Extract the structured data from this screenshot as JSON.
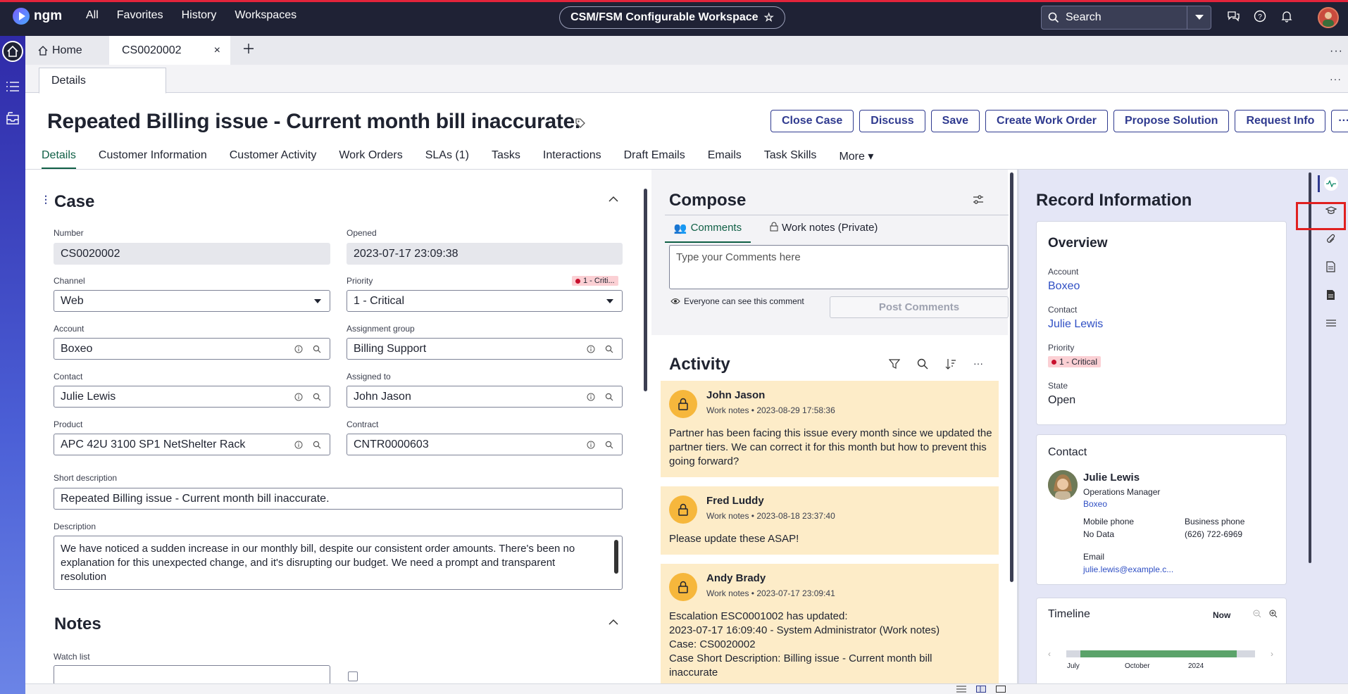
{
  "topbar": {
    "brand": "ngm",
    "nav": [
      "All",
      "Favorites",
      "History",
      "Workspaces"
    ],
    "workspace": "CSM/FSM Configurable Workspace",
    "search_placeholder": "Search"
  },
  "tabs": {
    "home": "Home",
    "record": "CS0020002",
    "details_tab": "Details"
  },
  "record": {
    "title": "Repeated Billing issue - Current month bill inaccurate.",
    "actions": [
      "Close Case",
      "Discuss",
      "Save",
      "Create Work Order",
      "Propose Solution",
      "Request Info"
    ],
    "form_tabs": [
      "Details",
      "Customer Information",
      "Customer Activity",
      "Work Orders",
      "SLAs (1)",
      "Tasks",
      "Interactions",
      "Draft Emails",
      "Emails",
      "Task Skills",
      "More"
    ]
  },
  "case": {
    "heading": "Case",
    "number_label": "Number",
    "number": "CS0020002",
    "opened_label": "Opened",
    "opened": "2023-07-17 23:09:38",
    "channel_label": "Channel",
    "channel": "Web",
    "priority_label": "Priority",
    "priority": "1 - Critical",
    "priority_badge": "1 - Criti...",
    "account_label": "Account",
    "account": "Boxeo",
    "group_label": "Assignment group",
    "group": "Billing Support",
    "contact_label": "Contact",
    "contact": "Julie Lewis",
    "assigned_label": "Assigned to",
    "assigned": "John Jason",
    "product_label": "Product",
    "product": "APC 42U 3100 SP1 NetShelter Rack",
    "contract_label": "Contract",
    "contract": "CNTR0000603",
    "short_label": "Short description",
    "short": "Repeated Billing issue - Current month bill inaccurate.",
    "desc_label": "Description",
    "desc": "We have noticed a sudden increase in our monthly bill, despite our consistent order amounts. There's been no explanation for this unexpected change, and it's disrupting our budget.  We need a prompt and transparent resolution",
    "notes_heading": "Notes",
    "watch_label": "Watch list"
  },
  "compose": {
    "heading": "Compose",
    "tab_comments": "Comments",
    "tab_worknotes": "Work notes (Private)",
    "placeholder": "Type your Comments here",
    "visibility": "Everyone can see this comment",
    "post": "Post Comments"
  },
  "activity": {
    "heading": "Activity",
    "items": [
      {
        "name": "John Jason",
        "meta": "Work notes • 2023-08-29 17:58:36",
        "body": "Partner has been facing this issue every month since we updated the partner tiers. We can correct it for this month but how to prevent this going forward?"
      },
      {
        "name": "Fred Luddy",
        "meta": "Work notes • 2023-08-18 23:37:40",
        "body": "Please update these ASAP!"
      },
      {
        "name": "Andy Brady",
        "meta": "Work notes • 2023-07-17 23:09:41",
        "body_lines": [
          "Escalation ESC0001002 has updated:",
          "2023-07-17 16:09:40 - System Administrator (Work notes)",
          "Case: CS0020002",
          "Case Short Description: Billing issue - Current month bill",
          "inaccurate"
        ]
      }
    ]
  },
  "recinfo": {
    "heading": "Record Information",
    "overview": "Overview",
    "account_label": "Account",
    "account": "Boxeo",
    "contact_label": "Contact",
    "contact": "Julie Lewis",
    "priority_label": "Priority",
    "priority": "1 - Critical",
    "state_label": "State",
    "state": "Open",
    "contact_card": {
      "heading": "Contact",
      "name": "Julie Lewis",
      "title": "Operations Manager",
      "company": "Boxeo",
      "mobile_label": "Mobile phone",
      "mobile": "No Data",
      "business_label": "Business phone",
      "business": "(626) 722-6969",
      "email_label": "Email",
      "email": "julie.lewis@example.c..."
    },
    "timeline": {
      "heading": "Timeline",
      "now": "Now",
      "ticks": [
        "July",
        "October",
        "2024"
      ]
    }
  },
  "colors": {
    "accent": "#2f3a8f",
    "active_tab": "#0f5f45",
    "activity_card": "#fdecc8",
    "critical": "#c8102e"
  }
}
